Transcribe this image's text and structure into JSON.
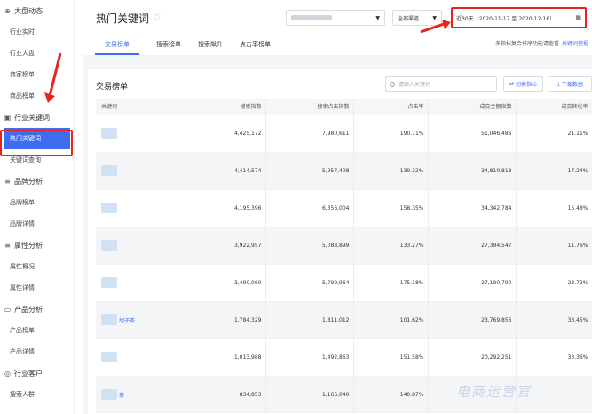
{
  "sidebar": {
    "groups": [
      {
        "icon": "dashboard-icon",
        "label": "大盘动态",
        "items": [
          {
            "label": "行业实时"
          },
          {
            "label": "行业大盘"
          },
          {
            "label": "商家榜单"
          },
          {
            "label": "商品榜单"
          }
        ]
      },
      {
        "icon": "document-icon",
        "label": "行业关键词",
        "items": [
          {
            "label": "热门关键词",
            "active": true
          },
          {
            "label": "关键词查询"
          }
        ]
      },
      {
        "icon": "list-icon",
        "label": "品牌分析",
        "items": [
          {
            "label": "品牌榜单"
          },
          {
            "label": "品牌详情"
          }
        ]
      },
      {
        "icon": "list-icon",
        "label": "属性分析",
        "items": [
          {
            "label": "属性概况"
          },
          {
            "label": "属性详情"
          }
        ]
      },
      {
        "icon": "folder-icon",
        "label": "产品分析",
        "items": [
          {
            "label": "产品榜单"
          },
          {
            "label": "产品详情"
          }
        ]
      },
      {
        "icon": "circle-icon",
        "label": "行业客户",
        "items": [
          {
            "label": "搜索人群"
          }
        ]
      }
    ]
  },
  "header": {
    "title": "热门关键词",
    "channel_select": "全部渠道",
    "date_range": "近30天（2020-11-17 至 2020-12-16）",
    "tabs": [
      {
        "label": "交易榜单",
        "active": true
      },
      {
        "label": "搜索榜单"
      },
      {
        "label": "搜索飙升"
      },
      {
        "label": "点击率榜单"
      }
    ],
    "hint": "多指标复合排序功能请查看",
    "hint_link": "关键词挖掘"
  },
  "card": {
    "title": "交易榜单",
    "search_placeholder": "请输入关键词",
    "switch_button": "切换指标",
    "download_button": "下载数据",
    "columns": [
      "关键词",
      "搜索指数",
      "搜索点击指数",
      "点击率",
      "成交金额指数",
      "成交转化率"
    ],
    "rows": [
      {
        "keyword": "",
        "search_index": "4,425,172",
        "click_index": "7,980,611",
        "ctr": "190.71%",
        "gmv_index": "51,046,486",
        "conversion": "21.11%"
      },
      {
        "keyword": "",
        "search_index": "4,414,574",
        "click_index": "5,957,408",
        "ctr": "139.32%",
        "gmv_index": "34,810,818",
        "conversion": "17.24%"
      },
      {
        "keyword": "",
        "search_index": "4,195,396",
        "click_index": "6,356,004",
        "ctr": "158.35%",
        "gmv_index": "34,342,784",
        "conversion": "15.48%"
      },
      {
        "keyword": "",
        "search_index": "3,922,957",
        "click_index": "5,088,899",
        "ctr": "133.27%",
        "gmv_index": "27,394,547",
        "conversion": "11.76%"
      },
      {
        "keyword": "",
        "search_index": "3,490,060",
        "click_index": "5,799,964",
        "ctr": "175.18%",
        "gmv_index": "27,190,790",
        "conversion": "23.72%"
      },
      {
        "keyword": "胡子茶",
        "search_index": "1,784,329",
        "click_index": "1,811,012",
        "ctr": "101.62%",
        "gmv_index": "23,769,856",
        "conversion": "33.45%"
      },
      {
        "keyword": "",
        "search_index": "1,013,988",
        "click_index": "1,492,863",
        "ctr": "151.58%",
        "gmv_index": "20,292,251",
        "conversion": "33.36%"
      },
      {
        "keyword": "茶",
        "search_index": "834,853",
        "click_index": "1,166,040",
        "ctr": "140.87%",
        "gmv_index": "",
        "conversion": ""
      }
    ]
  },
  "watermark": "电商运营官",
  "colors": {
    "accent": "#3f6df1",
    "highlight": "#e52420",
    "row_alt": "#f4f5f7"
  }
}
